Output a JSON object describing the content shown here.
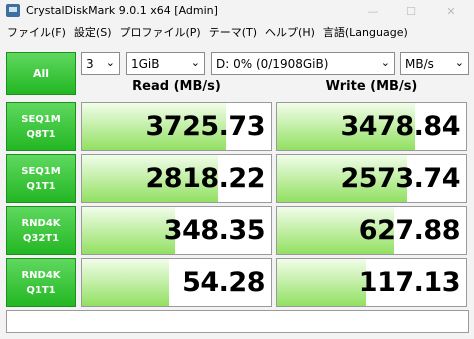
{
  "window": {
    "title": "CrystalDiskMark 9.0.1 x64 [Admin]",
    "min_glyph": "—",
    "max_glyph": "☐",
    "close_glyph": "✕"
  },
  "menu": [
    "ファイル(F)",
    "設定(S)",
    "プロファイル(P)",
    "テーマ(T)",
    "ヘルプ(H)",
    "言語(Language)"
  ],
  "controls": {
    "all_label": "All",
    "count": "3",
    "size": "1GiB",
    "drive": "D: 0% (0/1908GiB)",
    "unit": "MB/s",
    "caret": "⌄"
  },
  "headers": {
    "read": "Read (MB/s)",
    "write": "Write (MB/s)"
  },
  "rows": [
    {
      "line1": "SEQ1M",
      "line2": "Q8T1",
      "read": "3725.73",
      "write": "3478.84",
      "read_fill": 0.76,
      "write_fill": 0.73
    },
    {
      "line1": "SEQ1M",
      "line2": "Q1T1",
      "read": "2818.22",
      "write": "2573.74",
      "read_fill": 0.72,
      "write_fill": 0.69
    },
    {
      "line1": "RND4K",
      "line2": "Q32T1",
      "read": "348.35",
      "write": "627.88",
      "read_fill": 0.49,
      "write_fill": 0.62
    },
    {
      "line1": "RND4K",
      "line2": "Q1T1",
      "read": "54.28",
      "write": "117.13",
      "read_fill": 0.46,
      "write_fill": 0.47
    }
  ],
  "comment": ""
}
